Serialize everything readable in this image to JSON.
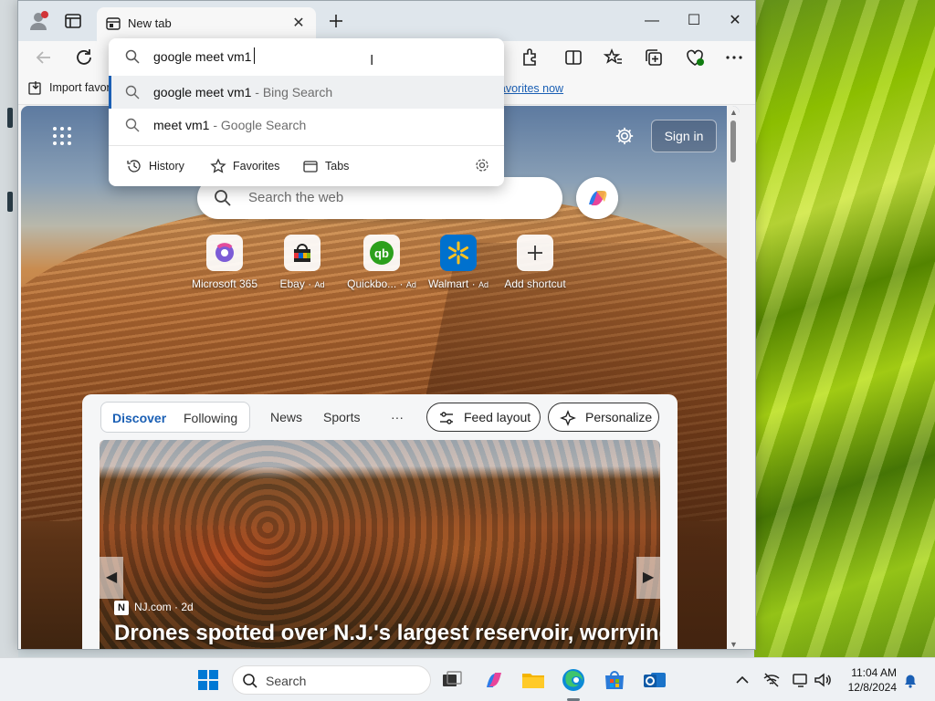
{
  "browser": {
    "tab": {
      "title": "New tab"
    },
    "favorites_bar": {
      "import_label": "Import favorites",
      "manage_link": "e favorites now"
    }
  },
  "omnibox": {
    "query": "google meet vm1",
    "suggestions": [
      {
        "text": "google meet vm1",
        "hint": " - Bing Search"
      },
      {
        "text": "meet vm1",
        "hint": " - Google Search"
      }
    ],
    "chips": [
      {
        "label": "History",
        "icon": "history-icon"
      },
      {
        "label": "Favorites",
        "icon": "star-icon"
      },
      {
        "label": "Tabs",
        "icon": "tabs-icon"
      }
    ]
  },
  "newtab": {
    "signin_label": "Sign in",
    "search_placeholder": "Search the web",
    "shortcuts": [
      {
        "label": "Microsoft 365",
        "ad": ""
      },
      {
        "label": "Ebay",
        "ad": "Ad"
      },
      {
        "label": "Quickbo...",
        "ad": "Ad"
      },
      {
        "label": "Walmart",
        "ad": "Ad"
      },
      {
        "label": "Add shortcut",
        "ad": ""
      }
    ]
  },
  "feed": {
    "pivots": [
      "Discover",
      "Following"
    ],
    "tabs": [
      "News",
      "Sports"
    ],
    "more": "···",
    "feed_layout_label": "Feed layout",
    "personalize_label": "Personalize",
    "hero": {
      "source": "NJ.com · 2d",
      "source_icon_letter": "N",
      "headline": "Drones spotted over N.J.'s largest reservoir, worrying"
    }
  },
  "taskbar": {
    "search_label": "Search",
    "time": "11:04 AM",
    "date": "12/8/2024"
  },
  "colors": {
    "accent": "#1a5fb4",
    "taskbar": "#eef1f4"
  }
}
